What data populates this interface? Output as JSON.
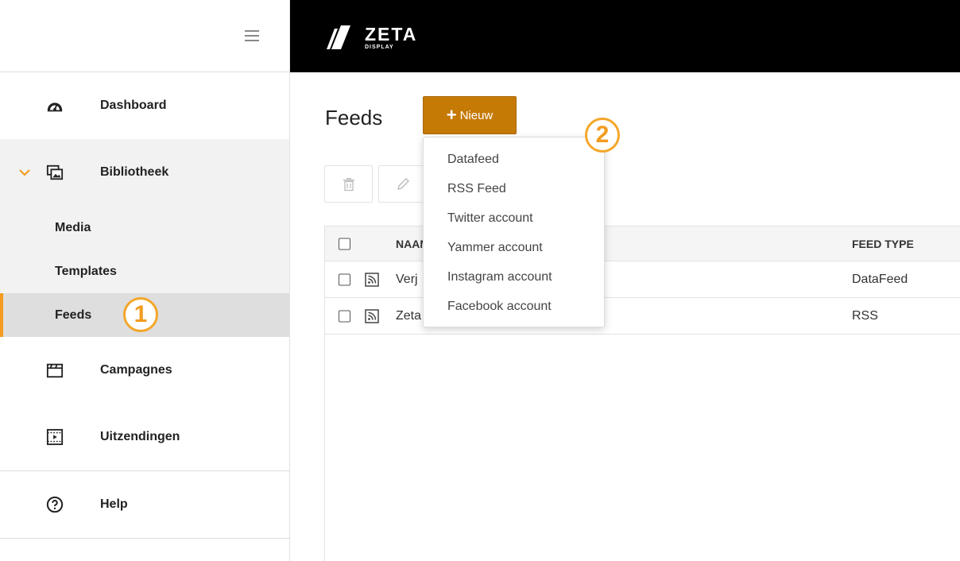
{
  "brand": {
    "name": "ZETA",
    "sub": "DISPLAY"
  },
  "sidebar": {
    "items": [
      {
        "label": "Dashboard"
      },
      {
        "label": "Bibliotheek"
      },
      {
        "label": "Campagnes"
      },
      {
        "label": "Uitzendingen"
      },
      {
        "label": "Help"
      }
    ],
    "subitems": [
      {
        "label": "Media"
      },
      {
        "label": "Templates"
      },
      {
        "label": "Feeds"
      }
    ]
  },
  "callouts": {
    "one": "1",
    "two": "2"
  },
  "main": {
    "title": "Feeds",
    "new_button": "Nieuw",
    "table": {
      "headers": {
        "name": "NAAM",
        "type": "FEED TYPE"
      },
      "rows": [
        {
          "name": "Verj",
          "type": "DataFeed"
        },
        {
          "name": "Zeta",
          "type": "RSS"
        }
      ]
    }
  },
  "dropdown": {
    "items": [
      "Datafeed",
      "RSS Feed",
      "Twitter account",
      "Yammer account",
      "Instagram account",
      "Facebook account"
    ]
  },
  "colors": {
    "accent": "#f39c1f",
    "button": "#c57a06",
    "topbar": "#000000"
  }
}
